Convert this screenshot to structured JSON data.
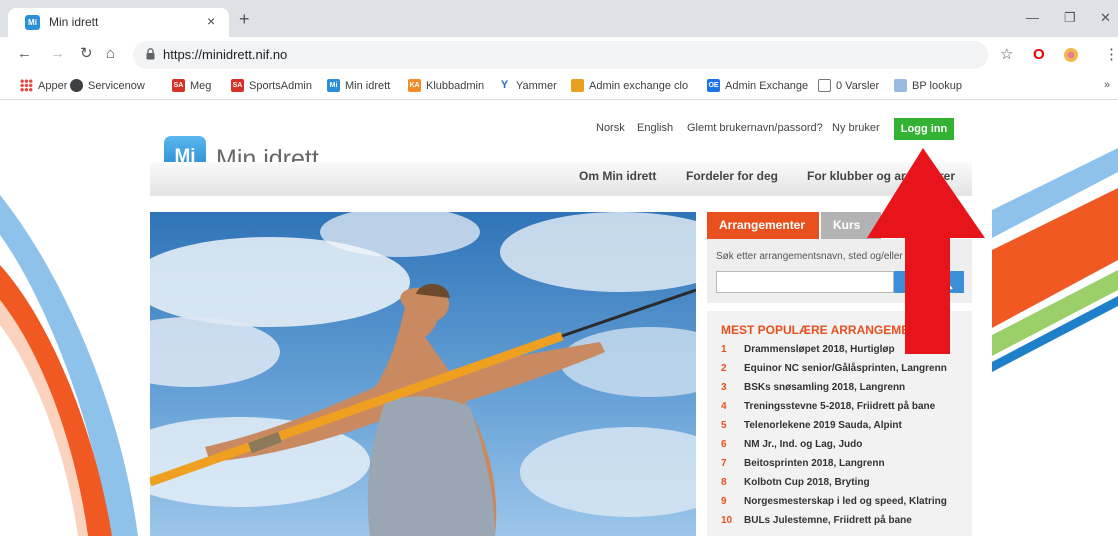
{
  "browser": {
    "tab_title": "Min idrett",
    "tab_favicon_text": "Mi",
    "tab_close": "×",
    "new_tab": "+",
    "url": "https://minidrett.nif.no",
    "bookmarks_overflow": "»",
    "bookmarks": [
      {
        "label": "Apper",
        "color": "#e8453c"
      },
      {
        "label": "Servicenow",
        "color": "#3c4043"
      },
      {
        "label": "Meg",
        "color": "#d93025",
        "badge": "SA"
      },
      {
        "label": "SportsAdmin",
        "color": "#d93025",
        "badge": "SA"
      },
      {
        "label": "Min idrett",
        "color": "#2b8fd6",
        "badge": "Mi"
      },
      {
        "label": "Klubbadmin",
        "color": "#f28c28",
        "badge": "KA"
      },
      {
        "label": "Yammer",
        "color": "#1f6fc5",
        "badge": "Y"
      },
      {
        "label": "Admin exchange clo",
        "color": "#e8a020"
      },
      {
        "label": "Admin Exchange",
        "color": "#1a73e8",
        "badge": "OE"
      },
      {
        "label": "0 Varsler",
        "color": "#ffffff"
      },
      {
        "label": "BP lookup",
        "color": "#9ab8e0"
      }
    ]
  },
  "site": {
    "logo_badge": "Mi",
    "logo_text": "Min idrett",
    "top_links": [
      "Norsk",
      "English",
      "Glemt brukernavn/passord?",
      "Ny bruker"
    ],
    "login_label": "Logg inn",
    "nav": [
      "Om Min idrett",
      "Fordeler for deg",
      "For klubber og arrangører"
    ],
    "tabs": [
      "Arrangementer",
      "Kurs"
    ],
    "search_label": "Søk etter arrangementsnavn, sted og/eller",
    "search_value": "",
    "popular_title": "MEST POPULÆRE ARRANGEMENTER",
    "popular": [
      {
        "n": "1",
        "text": "Drammensløpet 2018, Hurtigløp"
      },
      {
        "n": "2",
        "text": "Equinor NC senior/Gålåsprinten, Langrenn"
      },
      {
        "n": "3",
        "text": "BSKs snøsamling 2018, Langrenn"
      },
      {
        "n": "4",
        "text": "Treningsstevne 5-2018, Friidrett på bane"
      },
      {
        "n": "5",
        "text": "Telenorlekene 2019 Sauda, Alpint"
      },
      {
        "n": "6",
        "text": "NM Jr., Ind. og Lag, Judo"
      },
      {
        "n": "7",
        "text": "Beitosprinten 2018, Langrenn"
      },
      {
        "n": "8",
        "text": "Kolbotn Cup 2018, Bryting"
      },
      {
        "n": "9",
        "text": "Norgesmesterskap i led og speed, Klatring"
      },
      {
        "n": "10",
        "text": "BULs Julestemne, Friidrett på bane"
      }
    ]
  },
  "colors": {
    "accent_orange": "#e8501e",
    "login_green": "#34b233",
    "annotation_red": "#e8141c"
  }
}
